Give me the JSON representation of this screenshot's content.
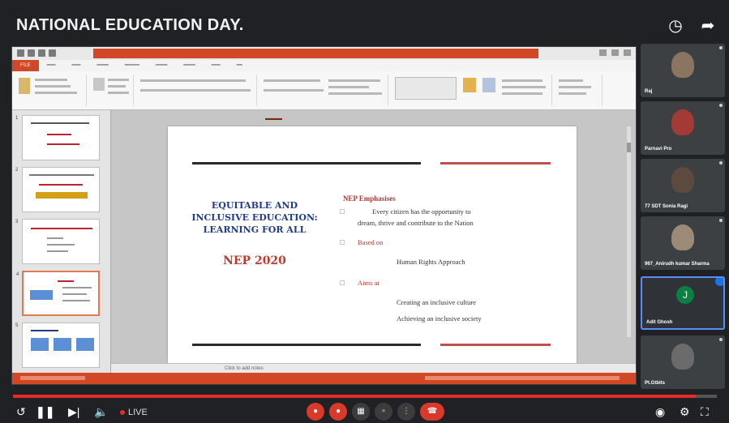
{
  "video": {
    "title": "NATIONAL EDUCATION DAY.",
    "live_label": "LIVE",
    "progress_fraction": 0.97
  },
  "icons": {
    "watch_later": "clock-icon",
    "share": "share-icon",
    "play_pause": "pause-icon",
    "next": "next-icon",
    "volume": "volume-icon",
    "miniplayer": "toggle-icon",
    "settings": "gear-icon",
    "fullscreen": "fullscreen-icon"
  },
  "slide": {
    "heading": "EQUITABLE AND INCLUSIVE EDUCATION: LEARNING FOR ALL",
    "subheading": "NEP 2020",
    "right_title": "NEP Emphasises",
    "lines": [
      "Every citizen has the opportunity to",
      "dream, thrive and      contribute to the Nation",
      "Based on",
      "Human Rights Approach",
      "Aims at",
      "Creating an inclusive culture",
      "Achieving an inclusive society"
    ]
  },
  "ppt": {
    "file_tab": "FILE",
    "notes_placeholder": "Click to add notes"
  },
  "participants": [
    {
      "name": "Raj"
    },
    {
      "name": "Parnavi Pro"
    },
    {
      "name": "77 SDT Sonia Ragi"
    },
    {
      "name": "967_Anirudh kumar Sharma"
    },
    {
      "name": "Adit Ghosh",
      "initial": "J"
    },
    {
      "name": "Pt.Gtbits"
    }
  ],
  "colors": {
    "ppt_accent": "#d24726",
    "meet_red": "#d9392b",
    "progress_red": "#e52d27",
    "active_border": "#5a8df5"
  }
}
